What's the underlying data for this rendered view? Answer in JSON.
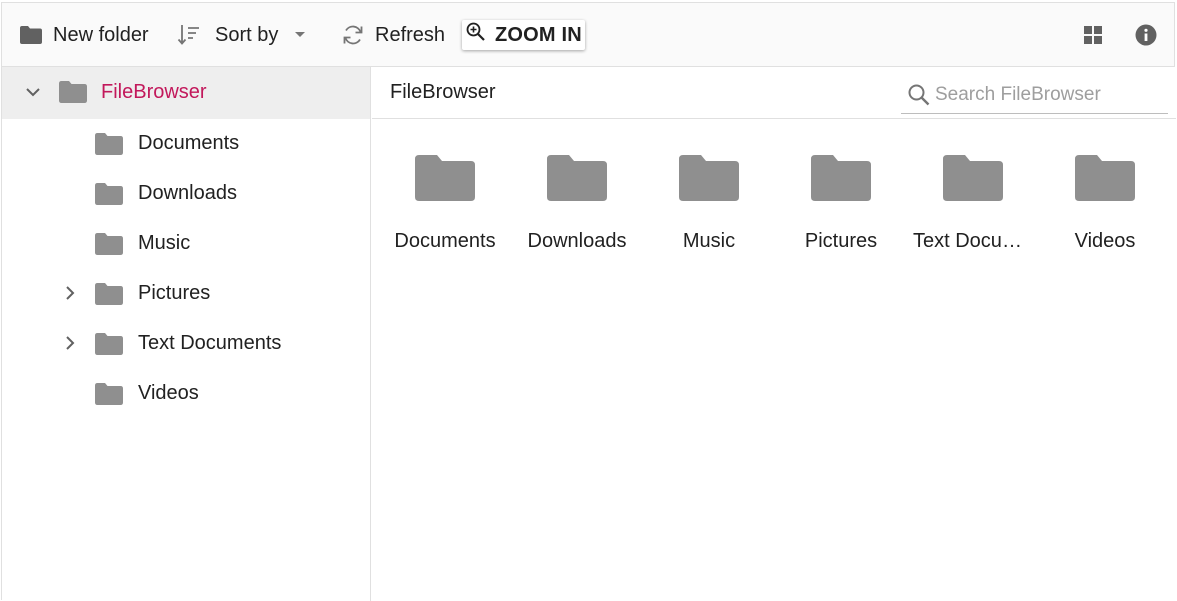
{
  "toolbar": {
    "new_folder_label": "New folder",
    "sort_by_label": "Sort by",
    "refresh_label": "Refresh",
    "zoom_label": "ZOOM IN",
    "icons": [
      "folder-icon",
      "sort-icon",
      "caret-down-icon",
      "refresh-icon",
      "zoom-in-icon",
      "grid-view-icon",
      "info-icon"
    ]
  },
  "navigation": {
    "root": {
      "label": "FileBrowser",
      "expanded": true
    },
    "items": [
      {
        "label": "Documents",
        "has_children": false
      },
      {
        "label": "Downloads",
        "has_children": false
      },
      {
        "label": "Music",
        "has_children": false
      },
      {
        "label": "Pictures",
        "has_children": true
      },
      {
        "label": "Text Documents",
        "has_children": true
      },
      {
        "label": "Videos",
        "has_children": false
      }
    ]
  },
  "content": {
    "breadcrumb": "FileBrowser",
    "search": {
      "placeholder": "Search FileBrowser",
      "value": ""
    },
    "files": [
      {
        "name": "Documents"
      },
      {
        "name": "Downloads"
      },
      {
        "name": "Music"
      },
      {
        "name": "Pictures"
      },
      {
        "name": "Text Documents"
      },
      {
        "name": "Videos"
      }
    ]
  },
  "colors": {
    "accent": "#c2185b",
    "folder": "#8f8f8f",
    "icon": "#757575",
    "selected_bg": "#eeeeee",
    "toolbar_bg": "#fafafa",
    "border": "#e0e0e0"
  }
}
